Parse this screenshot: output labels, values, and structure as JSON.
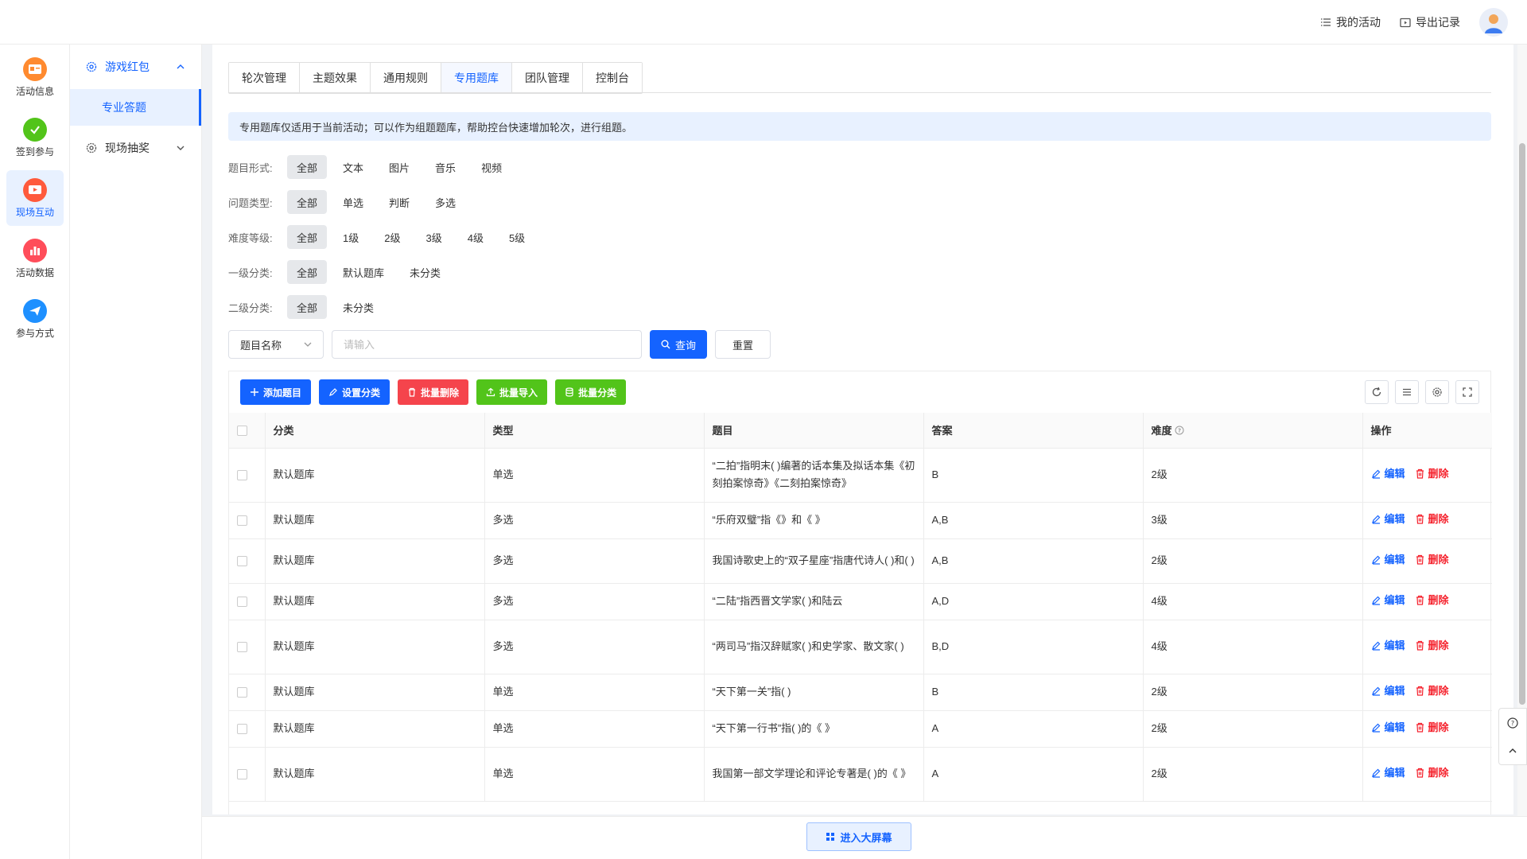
{
  "header": {
    "my_activity": "我的活动",
    "export_records": "导出记录"
  },
  "rail": [
    {
      "label": "活动信息",
      "icon": "activity-info-icon",
      "color": "#ff7a2f"
    },
    {
      "label": "签到参与",
      "icon": "checkin-icon",
      "color": "#52c41a"
    },
    {
      "label": "现场互动",
      "icon": "live-interact-icon",
      "color": "#ff5a3c"
    },
    {
      "label": "活动数据",
      "icon": "data-chart-icon",
      "color": "#ff4d5a"
    },
    {
      "label": "参与方式",
      "icon": "paper-plane-icon",
      "color": "#1e90ff"
    }
  ],
  "submenu": {
    "group1": "游戏红包",
    "group1_item": "专业答题",
    "group2": "现场抽奖"
  },
  "tabs": [
    "轮次管理",
    "主题效果",
    "通用规则",
    "专用题库",
    "团队管理",
    "控制台"
  ],
  "notice": "专用题库仅适用于当前活动；可以作为组题题库，帮助控台快速增加轮次，进行组题。",
  "filters": [
    {
      "label": "题目形式:",
      "options": [
        "全部",
        "文本",
        "图片",
        "音乐",
        "视频"
      ]
    },
    {
      "label": "问题类型:",
      "options": [
        "全部",
        "单选",
        "判断",
        "多选"
      ]
    },
    {
      "label": "难度等级:",
      "options": [
        "全部",
        "1级",
        "2级",
        "3级",
        "4级",
        "5级"
      ]
    },
    {
      "label": "一级分类:",
      "options": [
        "全部",
        "默认题库",
        "未分类"
      ]
    },
    {
      "label": "二级分类:",
      "options": [
        "全部",
        "未分类"
      ]
    }
  ],
  "search": {
    "field": "题目名称",
    "placeholder": "请输入",
    "query": "查询",
    "reset": "重置"
  },
  "toolbar": {
    "add": "添加题目",
    "set_category": "设置分类",
    "batch_delete": "批量删除",
    "batch_import": "批量导入",
    "batch_category": "批量分类",
    "colors": {
      "add": "#1463ff",
      "set_category": "#1463ff",
      "batch_delete": "#f5444c",
      "batch_import": "#52c41a",
      "batch_category": "#52c41a"
    }
  },
  "table": {
    "columns": [
      "分类",
      "类型",
      "题目",
      "答案",
      "难度",
      "操作"
    ],
    "edit": "编辑",
    "delete": "删除",
    "rows": [
      {
        "category": "默认题库",
        "type": "单选",
        "question": "“二拍”指明末( )编著的话本集及拟话本集《初刻拍案惊奇》《二刻拍案惊奇》",
        "answer": "B",
        "level": "2级"
      },
      {
        "category": "默认题库",
        "type": "多选",
        "question": "“乐府双璧”指《》和《 》",
        "answer": "A,B",
        "level": "3级"
      },
      {
        "category": "默认题库",
        "type": "多选",
        "question": "我国诗歌史上的“双子星座”指唐代诗人( )和( )",
        "answer": "A,B",
        "level": "2级"
      },
      {
        "category": "默认题库",
        "type": "多选",
        "question": "“二陆”指西晋文学家( )和陆云",
        "answer": "A,D",
        "level": "4级"
      },
      {
        "category": "默认题库",
        "type": "多选",
        "question": "“两司马”指汉辞赋家( )和史学家、散文家( )",
        "answer": "B,D",
        "level": "4级"
      },
      {
        "category": "默认题库",
        "type": "单选",
        "question": "“天下第一关”指( )",
        "answer": "B",
        "level": "2级"
      },
      {
        "category": "默认题库",
        "type": "单选",
        "question": "“天下第一行书”指( )的《 》",
        "answer": "A",
        "level": "2级"
      },
      {
        "category": "默认题库",
        "type": "单选",
        "question": "我国第一部文学理论和评论专著是( )的《 》",
        "answer": "A",
        "level": "2级"
      }
    ]
  },
  "bigscreen": "进入大屏幕"
}
